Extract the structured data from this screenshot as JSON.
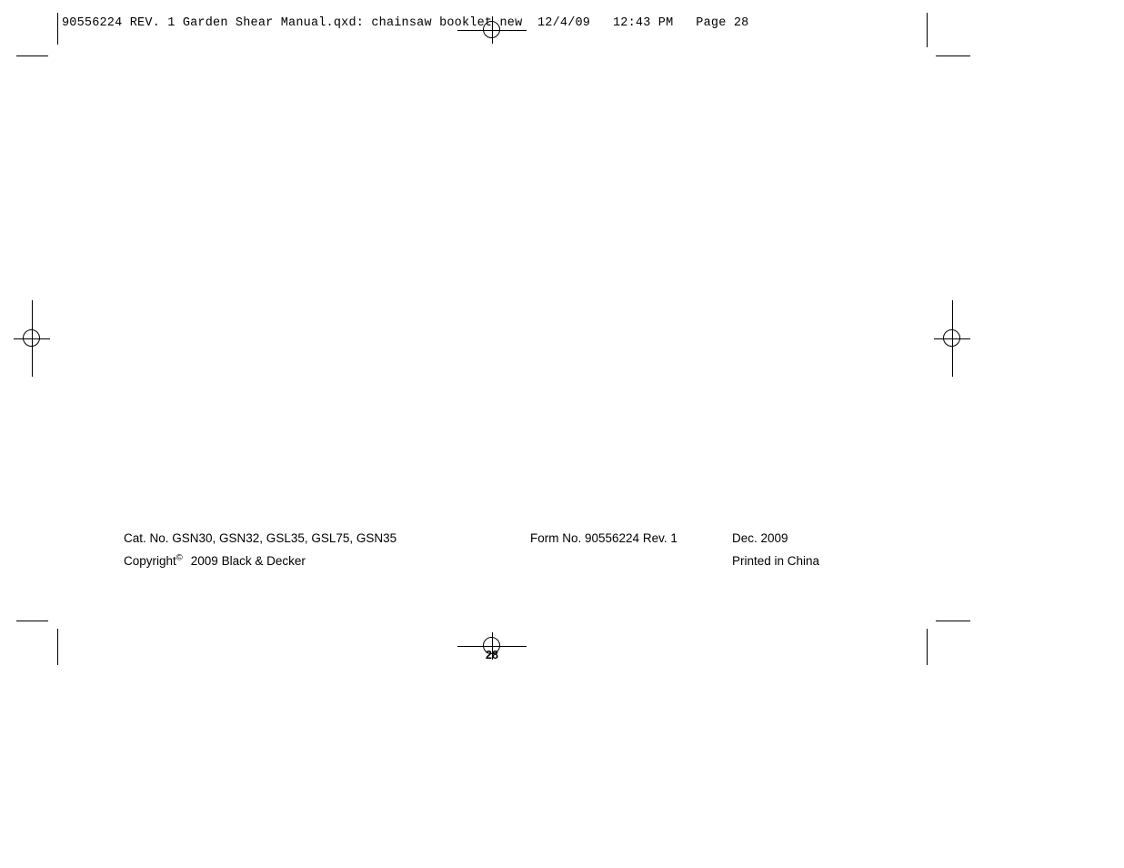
{
  "document": {
    "slug_line": "90556224 REV. 1 Garden Shear Manual.qxd: chainsaw booklet new  12/4/09   12:43 PM   Page 28",
    "page_number": "28"
  },
  "colophon": {
    "catalog_numbers": "Cat. No. GSN30, GSN32, GSL35, GSL75, GSN35",
    "form_number": "Form No. 90556224 Rev. 1",
    "date": "Dec. 2009",
    "copyright_word": "Copyright",
    "copyright_symbol": "©",
    "copyright_holder": "2009 Black & Decker",
    "printed_in": "Printed in China"
  },
  "marks": {
    "registration_top": "registration-target",
    "registration_bottom": "registration-target",
    "registration_left": "registration-target",
    "registration_right": "registration-target",
    "crop_top_left": "crop-mark",
    "crop_top_right": "crop-mark",
    "crop_bottom_left": "crop-mark",
    "crop_bottom_right": "crop-mark"
  },
  "colors": {
    "ink": "#000000",
    "paper": "#ffffff"
  }
}
